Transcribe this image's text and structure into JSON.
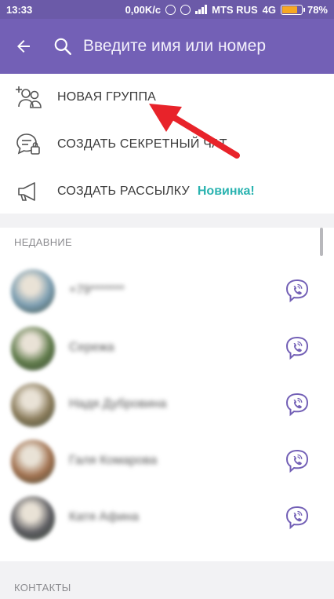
{
  "status_bar": {
    "time": "13:33",
    "speed": "0,00K/c",
    "carrier": "MTS RUS",
    "network": "4G",
    "battery_percent": "78%",
    "battery_level": 0.78
  },
  "header": {
    "back_icon": "arrow-left-icon",
    "search_icon": "search-icon",
    "search_placeholder": "Введите имя или номер"
  },
  "actions": [
    {
      "label": "НОВАЯ ГРУППА",
      "icon": "add-group-icon"
    },
    {
      "label": "СОЗДАТЬ СЕКРЕТНЫЙ ЧАТ",
      "icon": "secret-chat-icon"
    },
    {
      "label": "СОЗДАТЬ РАССЫЛКУ",
      "icon": "megaphone-icon",
      "badge": "Новинка!"
    }
  ],
  "recent": {
    "heading": "НЕДАВНИЕ",
    "items": [
      {
        "name": "+79*******",
        "avatar_color": "#7a9cb0",
        "action_icon": "viber-call-icon"
      },
      {
        "name": "Сережа",
        "avatar_color": "#5f7a4a",
        "action_icon": "viber-call-icon"
      },
      {
        "name": "Надя Дубровина",
        "avatar_color": "#8a7b5a",
        "action_icon": "viber-call-icon"
      },
      {
        "name": "Галя Комарова",
        "avatar_color": "#a0704e",
        "action_icon": "viber-call-icon"
      },
      {
        "name": "Катя Афина",
        "avatar_color": "#5b5b60",
        "action_icon": "viber-call-icon"
      }
    ]
  },
  "contacts": {
    "heading": "КОНТАКТЫ"
  },
  "colors": {
    "toolbar": "#7360b6",
    "accent": "#7360b6",
    "new_badge": "#2ab3b0",
    "arrow": "#e8232a"
  }
}
